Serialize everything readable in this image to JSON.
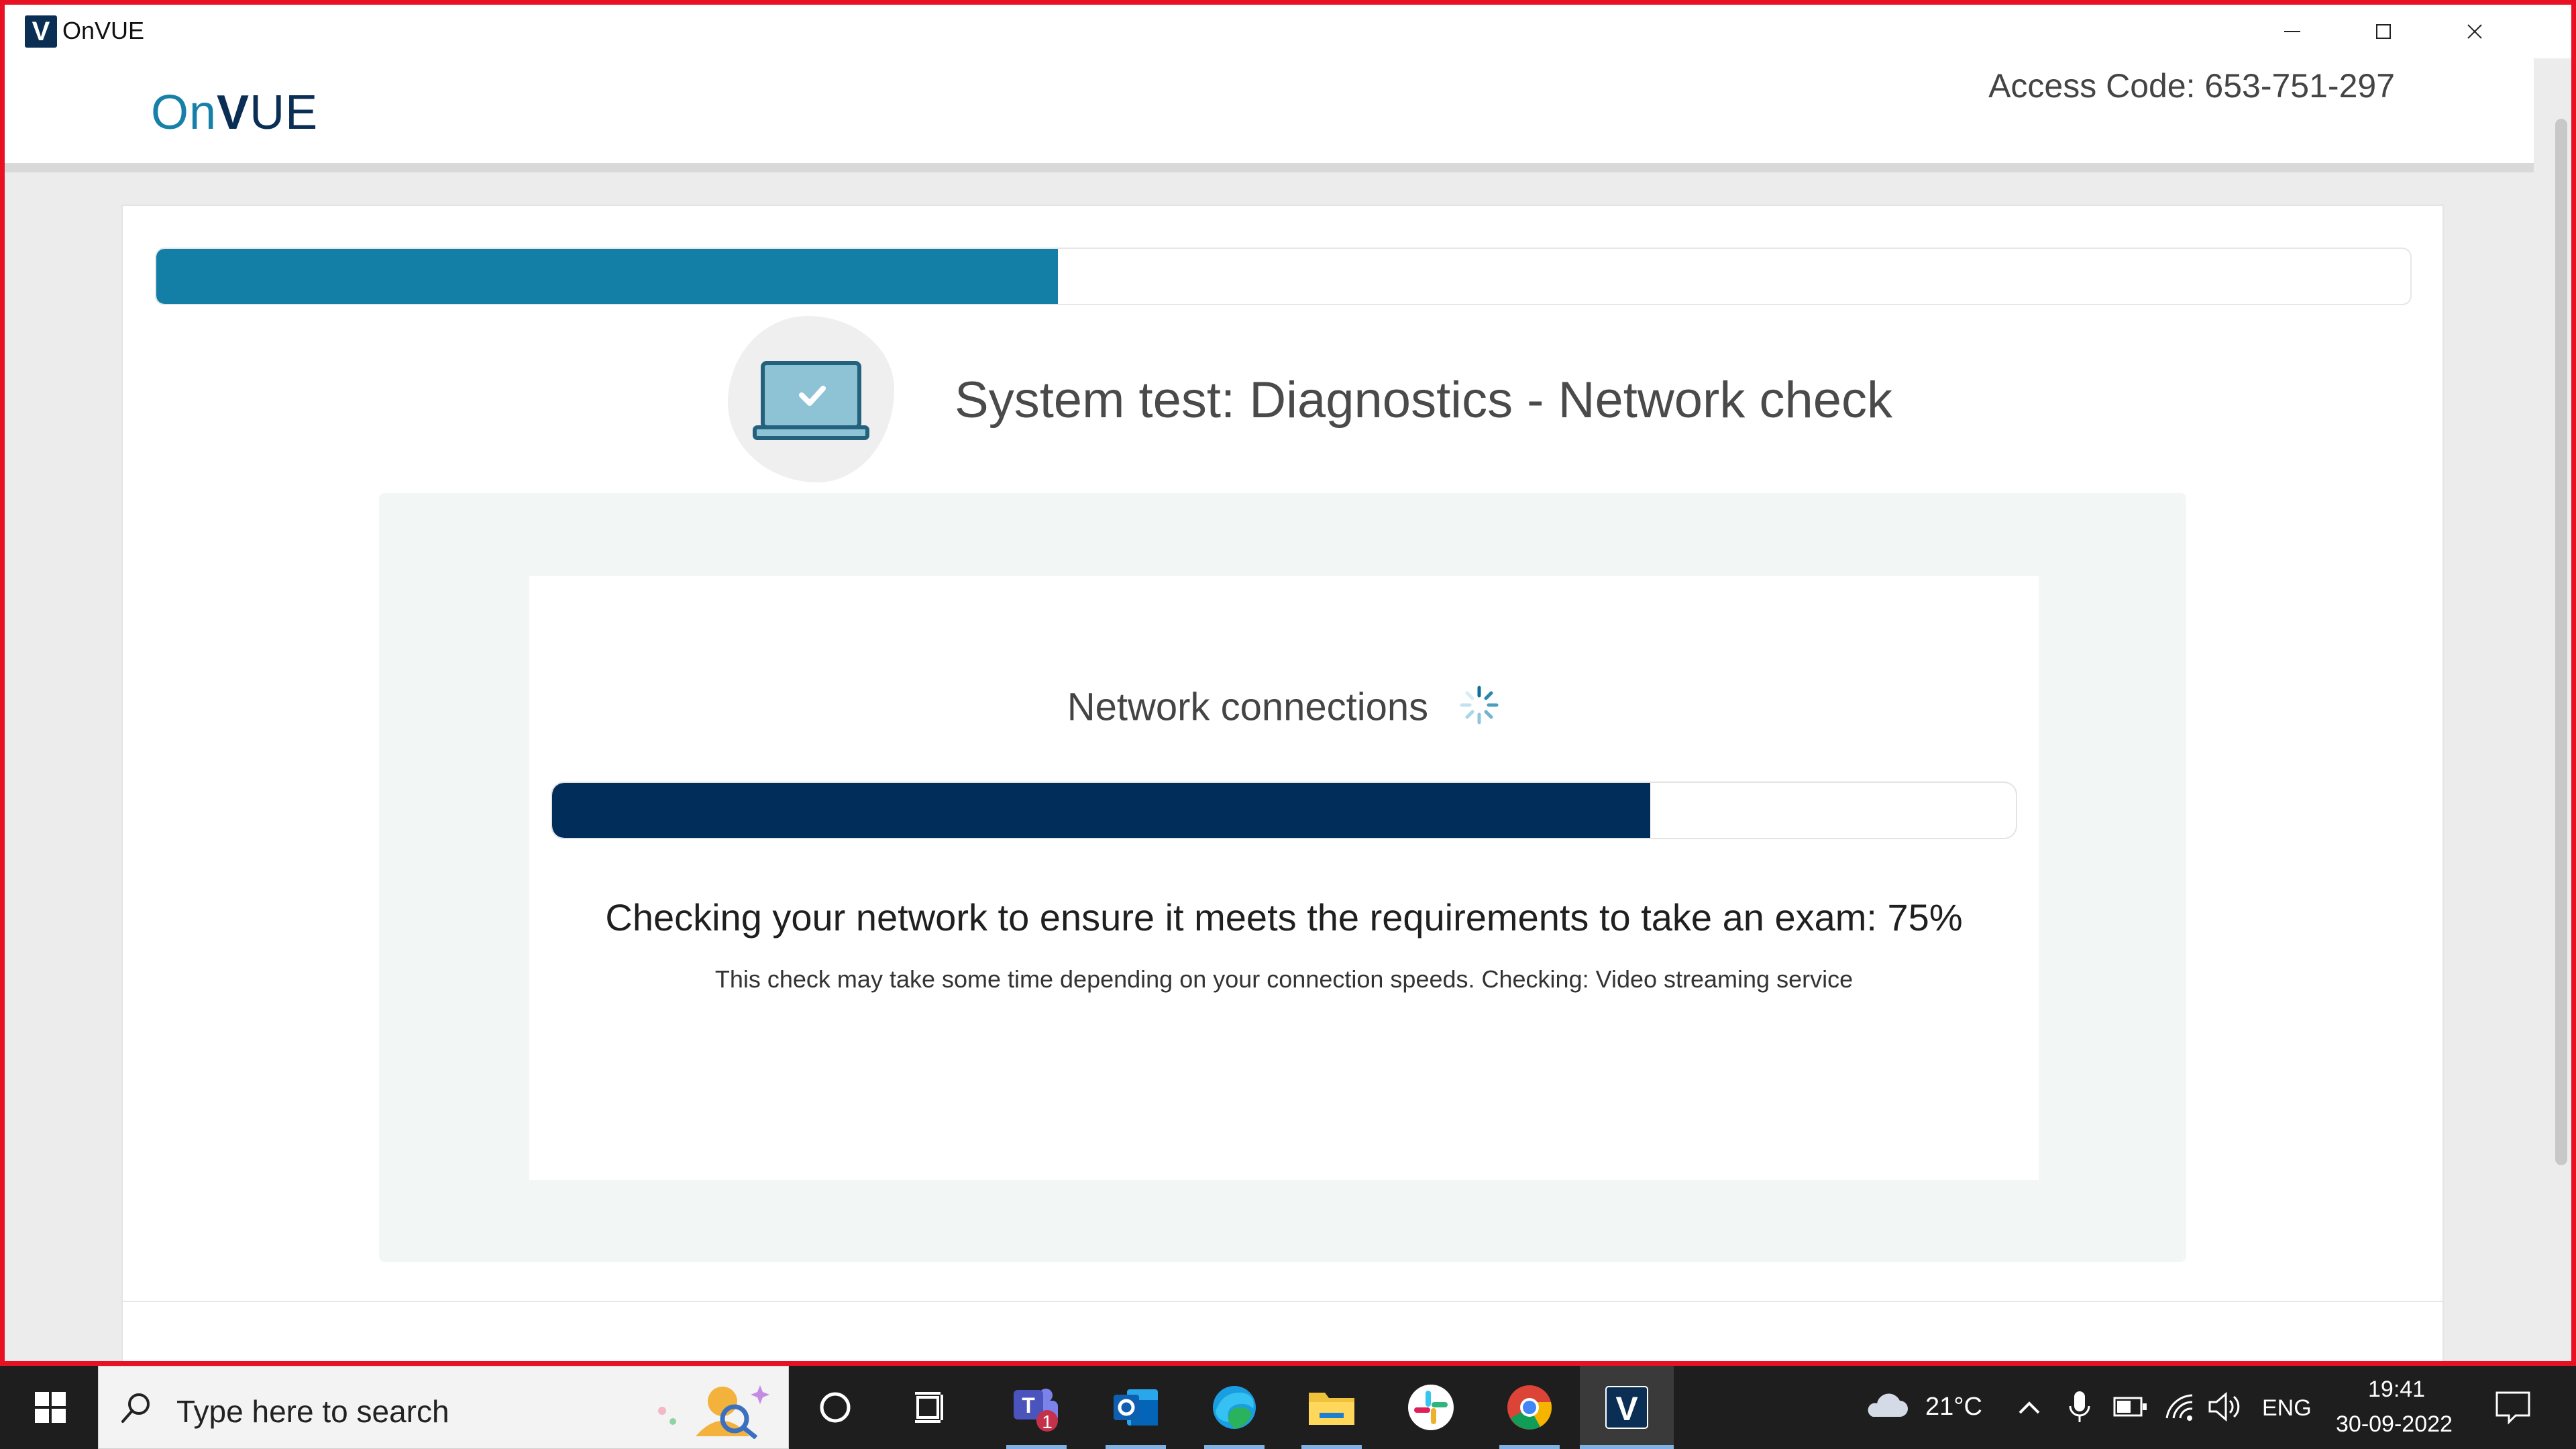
{
  "window": {
    "title": "OnVUE",
    "app_badge": "V",
    "accent_border": "#e81123"
  },
  "header": {
    "logo_on": "On",
    "logo_v": "V",
    "logo_ue": "UE",
    "access_code": "Access Code: 653-751-297"
  },
  "progress": {
    "overall_fraction": 0.4
  },
  "page": {
    "heading": "System test: Diagnostics - Network check"
  },
  "network": {
    "title": "Network connections",
    "progress_fraction": 0.75,
    "message": "Checking your network to ensure it meets the requirements to take an exam: 75%",
    "sub_message": "This check may take some time depending on your connection speeds. Checking: Video streaming service"
  },
  "colors": {
    "top_progress": "#137fa7",
    "network_progress": "#002d5a",
    "panel_bg": "#f2f6f5"
  },
  "taskbar": {
    "search_placeholder": "Type here to search",
    "apps": [
      "start-icon",
      "cortana-icon",
      "task-view-icon",
      "teams-icon",
      "outlook-icon",
      "edge-icon",
      "file-explorer-icon",
      "slack-icon",
      "chrome-icon",
      "onvue-icon"
    ],
    "teams_badge": "1",
    "weather": "21°C",
    "language": "ENG",
    "time": "19:41",
    "date": "30-09-2022"
  }
}
